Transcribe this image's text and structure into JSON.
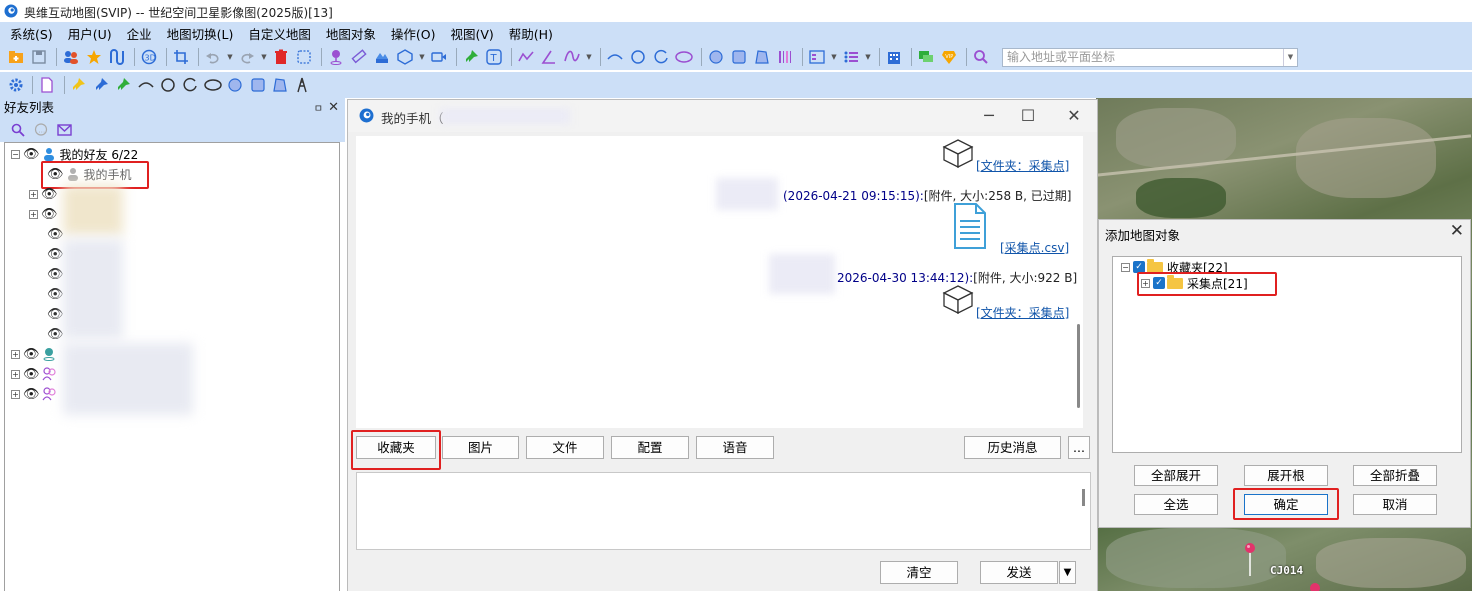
{
  "app": {
    "title": "奥维互动地图(SVIP) -- 世纪空间卫星影像图(2025版)[13]"
  },
  "menu": [
    "系统(S)",
    "用户(U)",
    "企业",
    "地图切换(L)",
    "自定义地图",
    "地图对象",
    "操作(O)",
    "视图(V)",
    "帮助(H)"
  ],
  "search": {
    "placeholder": "输入地址或平面坐标",
    "value": ""
  },
  "friends": {
    "header": "好友列表",
    "pin_glyph": "ㅁ",
    "close_glyph": "✕",
    "group_label": "我的好友 6/22",
    "my_phone": "我的手机"
  },
  "chat": {
    "title": "我的手机（",
    "messages": [
      {
        "link": "[文件夹：采集点]"
      },
      {
        "time": "(2026-04-21 09:15:15):",
        "text": "[附件, 大小:258 B, 已过期]",
        "link": "[采集点.csv]"
      },
      {
        "time": "2026-04-30 13:44:12):",
        "text": "[附件, 大小:922 B]",
        "link": "[文件夹：采集点]"
      }
    ],
    "buttons": {
      "favorites": "收藏夹",
      "image": "图片",
      "file": "文件",
      "config": "配置",
      "voice": "语音",
      "history": "历史消息",
      "more": "..."
    },
    "clear": "清空",
    "send": "发送"
  },
  "dialog": {
    "title": "添加地图对象",
    "tree": {
      "root": "收藏夹[22]",
      "child": "采集点[21]"
    },
    "buttons": {
      "expand_all": "全部展开",
      "expand_root": "展开根",
      "collapse_all": "全部折叠",
      "select_all": "全选",
      "ok": "确定",
      "cancel": "取消"
    }
  },
  "map": {
    "marker_label": "CJ014"
  },
  "colors": {
    "chrome": "#ccdff7",
    "highlight": "#e02020",
    "link": "#1155aa",
    "timestamp": "#000088"
  }
}
